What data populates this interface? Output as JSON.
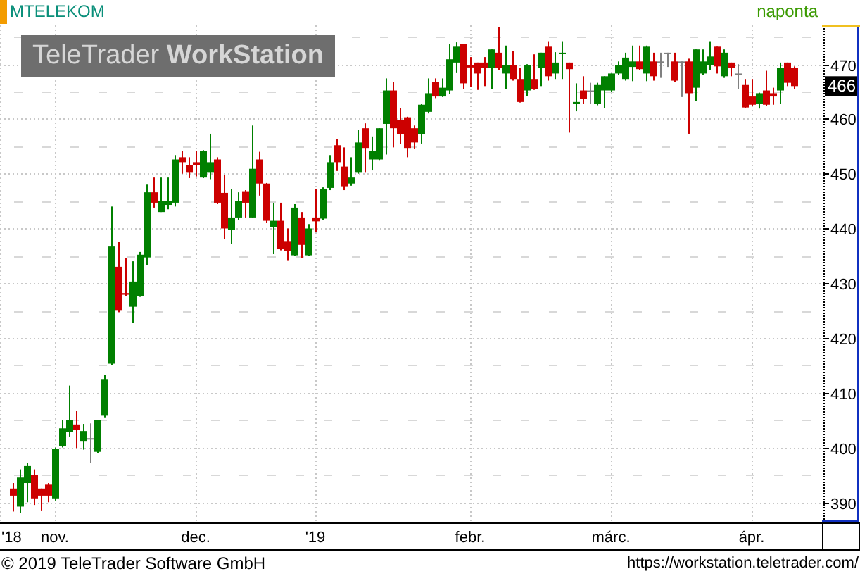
{
  "header": {
    "symbol": "MTELEKOM",
    "interval": "naponta"
  },
  "logo": "TeleTrader **WorkStation**",
  "chart": {
    "last_price": "466",
    "chart_data": {
      "type": "candlestick",
      "ylim": [
        386.3,
        477.1
      ],
      "grid": true,
      "yticks": [
        {
          "value": 390,
          "label": "390"
        },
        {
          "value": 400,
          "label": "400"
        },
        {
          "value": 410,
          "label": "410"
        },
        {
          "value": 420,
          "label": "420"
        },
        {
          "value": 430,
          "label": "430"
        },
        {
          "value": 440,
          "label": "440"
        },
        {
          "value": 450,
          "label": "450"
        },
        {
          "value": 460,
          "label": "460"
        },
        {
          "value": 470,
          "label": "470"
        }
      ],
      "categories": [
        "'18",
        null,
        null,
        null,
        null,
        null,
        "nov.",
        null,
        null,
        null,
        null,
        null,
        null,
        null,
        null,
        null,
        null,
        null,
        null,
        null,
        null,
        null,
        null,
        null,
        null,
        null,
        "dec.",
        null,
        null,
        null,
        null,
        null,
        null,
        null,
        null,
        null,
        null,
        null,
        null,
        null,
        null,
        null,
        null,
        "'19",
        null,
        null,
        null,
        null,
        null,
        null,
        null,
        null,
        null,
        null,
        null,
        null,
        null,
        null,
        null,
        null,
        null,
        null,
        null,
        null,
        null,
        "febr.",
        null,
        null,
        null,
        null,
        null,
        null,
        null,
        null,
        null,
        null,
        null,
        null,
        null,
        null,
        null,
        null,
        null,
        null,
        null,
        "márc.",
        null,
        null,
        null,
        null,
        null,
        null,
        null,
        null,
        null,
        null,
        null,
        null,
        null,
        null,
        null,
        null,
        null,
        null,
        null,
        "ápr.",
        null,
        null,
        null,
        null,
        null,
        null
      ],
      "ohlc": [
        [
          392.5,
          393.5,
          388.3,
          391.2
        ],
        [
          389.2,
          396,
          388,
          394.5
        ],
        [
          393.5,
          397.2,
          390,
          396.6
        ],
        [
          395,
          396,
          389.5,
          390.7
        ],
        [
          392.5,
          392.5,
          388.5,
          391.2
        ],
        [
          393.2,
          393.5,
          390,
          391.2
        ],
        [
          390.7,
          400,
          390.3,
          399.7
        ],
        [
          400.2,
          405,
          400,
          403.5
        ],
        [
          402.8,
          411.3,
          402,
          405
        ],
        [
          404.2,
          406.7,
          399.9,
          403.2
        ],
        [
          401.2,
          404.3,
          399.6,
          403
        ],
        [
          401.7,
          404.4,
          397.2,
          401.7
        ],
        [
          399.2,
          405,
          399,
          405
        ],
        [
          405.8,
          413.2,
          405.5,
          412.5
        ],
        [
          415.3,
          444,
          415,
          436.7
        ],
        [
          433,
          437.5,
          424.7,
          425.1
        ],
        [
          428.2,
          434.6,
          427.7,
          427.9
        ],
        [
          425.7,
          434,
          422.7,
          430.3
        ],
        [
          427.7,
          435.7,
          427.5,
          435.2
        ],
        [
          434.7,
          448,
          433.3,
          446.6
        ],
        [
          446.6,
          449.3,
          443.8,
          444.7
        ],
        [
          443,
          449.3,
          443,
          445
        ],
        [
          444.3,
          449.3,
          443.5,
          445
        ],
        [
          444.7,
          453.4,
          444,
          452.6
        ],
        [
          453,
          454.2,
          450,
          452.1
        ],
        [
          451.6,
          453,
          449.2,
          450.3
        ],
        [
          452.1,
          454.2,
          449.5,
          451.6
        ],
        [
          449.3,
          454.3,
          449.2,
          454.2
        ],
        [
          450.3,
          457.3,
          449,
          452.1
        ],
        [
          452.6,
          453,
          444.5,
          444.7
        ],
        [
          446.5,
          449.8,
          438,
          440
        ],
        [
          439.8,
          447.2,
          437.2,
          442
        ],
        [
          442,
          446.6,
          441.6,
          445
        ],
        [
          446.8,
          447,
          442,
          444.7
        ],
        [
          442,
          458.8,
          442,
          450.9
        ],
        [
          452.6,
          454,
          446,
          448.2
        ],
        [
          448.2,
          448.3,
          441,
          441.4
        ],
        [
          440.3,
          444.7,
          435.3,
          441.4
        ],
        [
          441.4,
          444.7,
          436,
          436.2
        ],
        [
          437.7,
          440,
          434.2,
          435.9
        ],
        [
          435.1,
          444.5,
          435,
          443.8
        ],
        [
          442,
          443,
          434.6,
          437
        ],
        [
          435.1,
          440.8,
          435,
          440
        ],
        [
          442,
          447.2,
          439.3,
          441.3
        ],
        [
          441.8,
          447.5,
          441.5,
          447.2
        ],
        [
          447.4,
          453.4,
          447,
          452.1
        ],
        [
          455.2,
          456.3,
          450.5,
          452.1
        ],
        [
          451.3,
          454.8,
          447,
          447.7
        ],
        [
          448.2,
          453,
          447.8,
          449.3
        ],
        [
          450.3,
          458,
          450,
          455.7
        ],
        [
          458.3,
          459.2,
          450.3,
          454.7
        ],
        [
          452.6,
          456.8,
          450.6,
          454.2
        ],
        [
          452.6,
          458.3,
          452.5,
          458.3
        ],
        [
          459.1,
          467.4,
          453.5,
          465.2
        ],
        [
          465.2,
          466.7,
          454.8,
          458.3
        ],
        [
          459.8,
          462,
          455.4,
          457.2
        ],
        [
          460.3,
          460.4,
          453,
          454.7
        ],
        [
          458.3,
          458.8,
          454.6,
          455.7
        ],
        [
          457.2,
          462.8,
          455.5,
          462.6
        ],
        [
          461.3,
          467.4,
          461,
          464.7
        ],
        [
          466.8,
          467.4,
          463.8,
          464.1
        ],
        [
          464.1,
          467.4,
          464,
          465.7
        ],
        [
          465.2,
          473.7,
          464.5,
          470.9
        ],
        [
          470.3,
          474,
          468.5,
          473.2
        ],
        [
          473.7,
          473.7,
          465.5,
          466.5
        ],
        [
          469.8,
          471.3,
          465.8,
          469.4
        ],
        [
          470.3,
          470.3,
          465.3,
          468.3
        ],
        [
          470.3,
          471.3,
          466,
          469.3
        ],
        [
          469.3,
          472.7,
          465.5,
          472.7
        ],
        [
          472.1,
          476.8,
          469,
          469.3
        ],
        [
          468.3,
          473.4,
          465.5,
          469.8
        ],
        [
          469.8,
          472.4,
          467,
          467.3
        ],
        [
          467.3,
          469.3,
          463,
          463.1
        ],
        [
          465.2,
          470,
          464.2,
          469.8
        ],
        [
          467.3,
          471.8,
          465.3,
          465.5
        ],
        [
          469.3,
          472.1,
          466,
          472.1
        ],
        [
          473.2,
          474.2,
          467,
          467.8
        ],
        [
          468.3,
          472.2,
          467.3,
          470.3
        ],
        [
          471.9,
          474.2,
          467.3,
          472.1
        ],
        [
          470.3,
          470.3,
          457.5,
          469.1
        ],
        [
          462.8,
          466.5,
          461.4,
          463.1
        ],
        [
          465.2,
          467.8,
          462.8,
          463.7
        ],
        [
          465.2,
          466.6,
          462.8,
          465.2
        ],
        [
          462.8,
          466.6,
          462.5,
          466.2
        ],
        [
          465.2,
          467.8,
          462,
          467.8
        ],
        [
          465.2,
          468.3,
          465,
          468.3
        ],
        [
          468.3,
          470.5,
          468,
          469.8
        ],
        [
          467.3,
          472.1,
          467,
          471.2
        ],
        [
          469.5,
          473.4,
          466.9,
          470.5
        ],
        [
          470.5,
          473.4,
          469,
          469.1
        ],
        [
          468.3,
          473.4,
          466.9,
          473.2
        ],
        [
          470.5,
          472.1,
          467,
          467.8
        ],
        [
          470.5,
          472.1,
          467.5,
          470.5
        ],
        [
          472.1,
          472.1,
          469.5,
          472.1
        ],
        [
          470.5,
          472.1,
          466.8,
          467
        ],
        [
          470.5,
          470.5,
          464,
          470.5
        ],
        [
          470.5,
          471,
          457.3,
          464.7
        ],
        [
          465.7,
          472.7,
          463.3,
          472.7
        ],
        [
          468.3,
          472.7,
          468,
          470.5
        ],
        [
          469.8,
          474.2,
          469,
          471.4
        ],
        [
          473.2,
          473.2,
          468.3,
          469.6
        ],
        [
          467.8,
          472.7,
          467.5,
          472.1
        ],
        [
          470.3,
          470.3,
          467.8,
          469.3
        ],
        [
          468.3,
          470,
          465.5,
          468.3
        ],
        [
          466.2,
          467.3,
          462,
          462.1
        ],
        [
          464.1,
          467.3,
          462.3,
          462.6
        ],
        [
          462.8,
          464.8,
          461.9,
          464.7
        ],
        [
          465.2,
          468.8,
          462.4,
          462.6
        ],
        [
          464.7,
          465.7,
          462.6,
          464.1
        ],
        [
          465.2,
          470.3,
          462.8,
          469.3
        ],
        [
          470.3,
          470.3,
          466,
          466.6
        ],
        [
          469.3,
          469.6,
          465.5,
          466
        ]
      ]
    }
  },
  "footer": {
    "copyright": "© 2019 TeleTrader Software GmbH",
    "url": "https://workstation.teletrader.com/"
  }
}
